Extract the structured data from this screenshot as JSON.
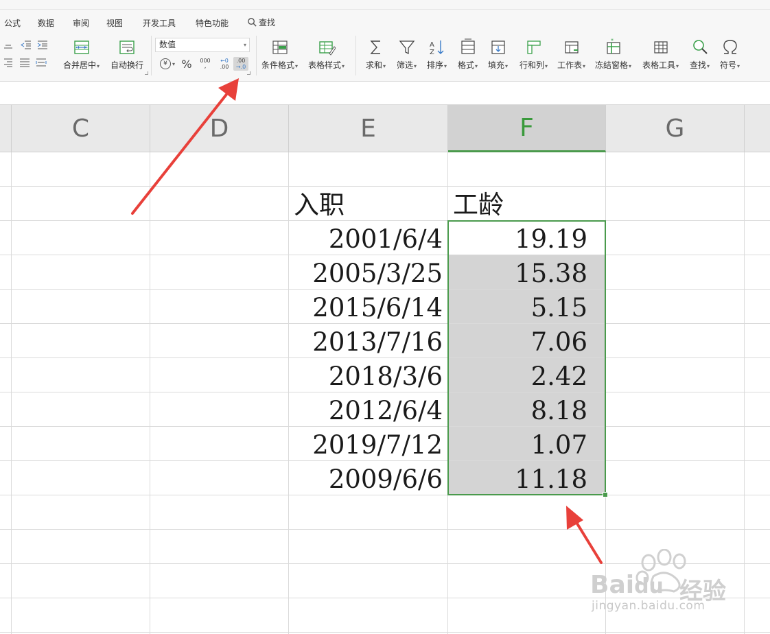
{
  "ribbon": {
    "tabs": [
      "公式",
      "数据",
      "审阅",
      "视图",
      "开发工具",
      "特色功能"
    ],
    "search_label": "查找",
    "merge_center_label": "合并居中",
    "wrap_text_label": "自动换行",
    "number_format_value": "数值",
    "conditional_format_label": "条件格式",
    "table_style_label": "表格样式",
    "sum_label": "求和",
    "filter_label": "筛选",
    "sort_label": "排序",
    "format_label": "格式",
    "fill_label": "填充",
    "row_col_label": "行和列",
    "worksheet_label": "工作表",
    "freeze_label": "冻结窗格",
    "table_tools_label": "表格工具",
    "find_label": "查找",
    "symbol_label": "符号",
    "currency_symbol": "¥",
    "percent_symbol": "%",
    "thousands_symbol": "000",
    "increase_decimal_top": "←0",
    "increase_decimal_bottom": ".00",
    "decrease_decimal_top": ".00",
    "decrease_decimal_bottom": "→.0"
  },
  "sheet": {
    "columns": [
      "C",
      "D",
      "E",
      "F",
      "G"
    ],
    "selected_column": "F",
    "header_entry": "入职",
    "header_tenure": "工龄",
    "rows": [
      {
        "entry_date": "2001/6/4",
        "tenure": "19.19"
      },
      {
        "entry_date": "2005/3/25",
        "tenure": "15.38"
      },
      {
        "entry_date": "2015/6/14",
        "tenure": "5.15"
      },
      {
        "entry_date": "2013/7/16",
        "tenure": "7.06"
      },
      {
        "entry_date": "2018/3/6",
        "tenure": "2.42"
      },
      {
        "entry_date": "2012/6/4",
        "tenure": "8.18"
      },
      {
        "entry_date": "2019/7/12",
        "tenure": "1.07"
      },
      {
        "entry_date": "2009/6/6",
        "tenure": "11.18"
      }
    ]
  },
  "watermark": {
    "brand_a": "Bai",
    "brand_b": "du",
    "brand_c": "经验",
    "url": "jingyan.baidu.com"
  },
  "colors": {
    "accent_green": "#4a9a4c",
    "arrow_red": "#e8403a",
    "selection_gray": "#d4d4d4"
  }
}
